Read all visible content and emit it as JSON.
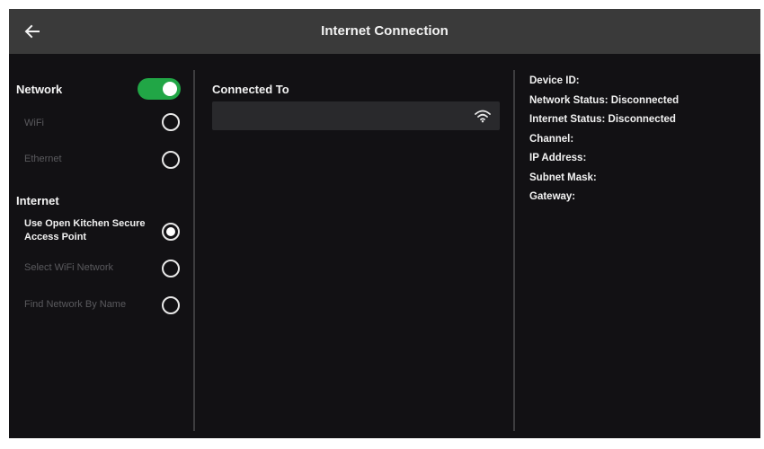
{
  "header": {
    "title": "Internet Connection",
    "back_icon": "arrow-left-icon"
  },
  "left_panel": {
    "network": {
      "label": "Network",
      "toggle_on": true,
      "options": [
        {
          "label": "WiFi",
          "selected": false,
          "enabled": false
        },
        {
          "label": "Ethernet",
          "selected": false,
          "enabled": false
        }
      ]
    },
    "internet": {
      "label": "Internet",
      "options": [
        {
          "label": "Use Open Kitchen Secure Access Point",
          "selected": true,
          "enabled": true
        },
        {
          "label": "Select WiFi Network",
          "selected": false,
          "enabled": false
        },
        {
          "label": "Find Network By Name",
          "selected": false,
          "enabled": false
        }
      ]
    }
  },
  "middle_panel": {
    "connected_label": "Connected To",
    "connected_value": "",
    "icon": "wifi-icon"
  },
  "right_panel": {
    "device_id": "Device ID:",
    "network_status": "Network Status: Disconnected",
    "internet_status": "Internet Status: Disconnected",
    "channel": "Channel:",
    "ip_address": "IP Address:",
    "subnet_mask": "Subnet Mask:",
    "gateway": "Gateway:"
  },
  "colors": {
    "background": "#121114",
    "header": "#3a3a3a",
    "toggle_on": "#21a646",
    "disabled_text": "#5a5a5e",
    "text": "#f2f2f2"
  }
}
